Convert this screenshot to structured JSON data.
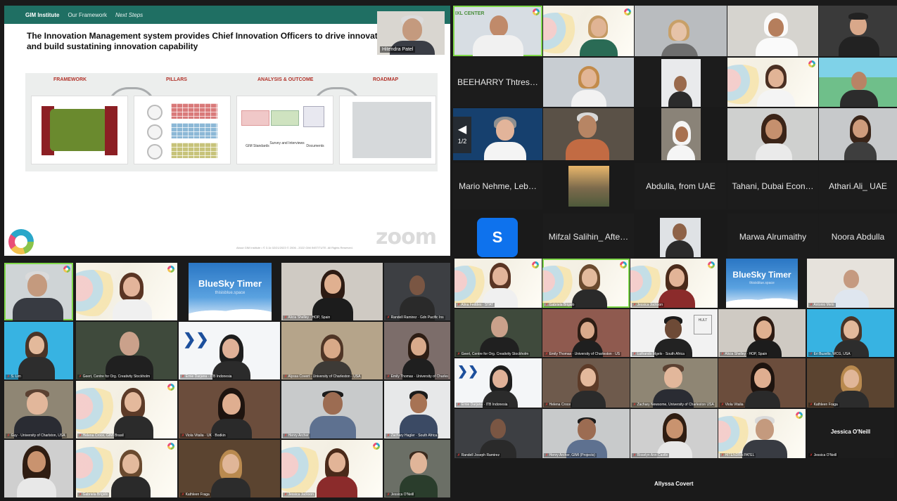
{
  "slide": {
    "nav": [
      "GIM Institute",
      "Our Framework",
      "Next Steps"
    ],
    "title": "The Innovation Management system provides Chief Innovation Officers to drive innovation and build sustatining innovation capability",
    "presenter_name": "Hitendra Patel",
    "logo_text": "IXL CENTER",
    "stages": [
      "FRAMEWORK",
      "PILLARS",
      "ANALYSIS & OUTCOME",
      "ROADMAP"
    ],
    "analysis_labels": [
      "GIM Standards",
      "Survey and Interviews",
      "Documents"
    ],
    "footer": "About GIM Institute • © 3.1k    02/21/2023    © 2006 - 2022 GIM INSTITUTE. All Rights Reserved.",
    "watermark": "zoom"
  },
  "top_right": {
    "logo_text": "IXL CENTER",
    "name_tiles": [
      "BEEHARRY Thtres…",
      "Mario Nehme, Leb…",
      "Abdulla, from UAE",
      "Tahani, Dubai Econ…",
      "Athari.Ali_ UAE",
      "Mifzal Salihin_ Afte…",
      "Marwa Alrumaithy",
      "Noora Abdulla"
    ],
    "avatar_letter": "S",
    "page_indicator": "1/2"
  },
  "bluesky": {
    "title": "BlueSky Timer",
    "subtitle": "thisisblue.space"
  },
  "bottom_left": {
    "tile_names": [
      "",
      "",
      "",
      "Alicia Shelley · HOP, Spain",
      "Randell Ramirez · Gdn Pacific Ins",
      "S. Lim",
      "Geert, Centre for Org. Creativity Stockholm",
      "Ernie Darjana · ITB Indonesia",
      "Alyssa Covert · University of Charleston · USA",
      "Emily Thomas · University of Charleston",
      "Guy · University of Charlston, USA",
      "Helena Croce, GIMI Brasil",
      "Viola Vitalia · UK · Bodkin",
      "Henry Archer",
      "Zachary Hagler · South Africa",
      "",
      "Gabriela Brigido",
      "Kathleen Fraga",
      "Jessica Jackson",
      "Jessica O'Neill"
    ]
  },
  "bottom_right": {
    "tile_names": [
      "Alina Feddes · STAT",
      "Gabriela Brigido",
      "Jessica Jackson",
      "BlueSky Timer",
      "Antonio Melo",
      "Geert, Centre for Org. Creativity Stockholm",
      "Emily Thomas · University of Charleston · US",
      "Luthando Mgelo · South Africa",
      "Alicia Shelley · HOP, Spain",
      "Eri Buzello, WCG, USA",
      "Ernie Darjana · ITB Indonesia",
      "Helena Croce",
      "Zachary Newsome, University of Charleston USA",
      "Viola Vitalia",
      "Kathleen Fraga",
      "Randell Joseph Ramirez",
      "Henry Archer, GIMI (Projects)",
      "Roselyn Ann Castle",
      "HITENDRA PATEL",
      "Jessica O'Neill"
    ],
    "name_only_tile": "Jessica O'Neill",
    "bottom_caption": "Allyssa Covert"
  }
}
